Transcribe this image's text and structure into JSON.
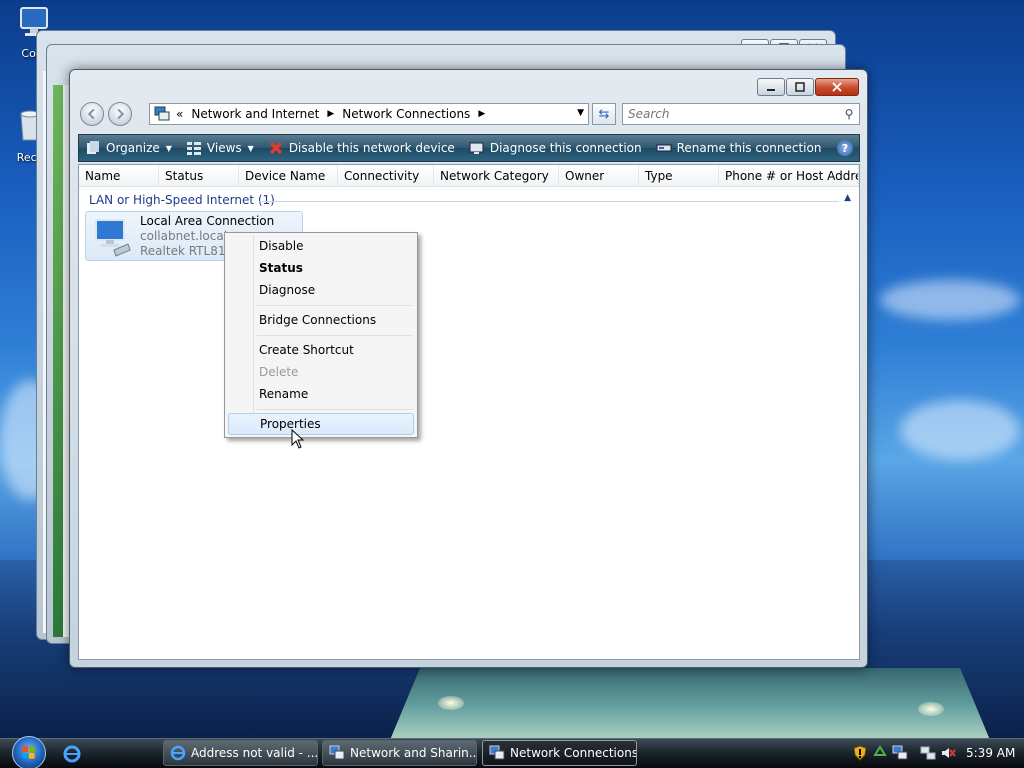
{
  "desktop": {
    "icons": [
      {
        "label": "Com"
      },
      {
        "label": "Recy"
      }
    ]
  },
  "window": {
    "address": {
      "crumbs": [
        "«",
        "Network and Internet",
        "Network Connections"
      ]
    },
    "search_placeholder": "Search",
    "toolbar": {
      "organize": "Organize",
      "views": "Views",
      "disable": "Disable this network device",
      "diagnose": "Diagnose this connection",
      "rename": "Rename this connection",
      "more": "»",
      "help": "?"
    },
    "columns": [
      "Name",
      "Status",
      "Device Name",
      "Connectivity",
      "Network Category",
      "Owner",
      "Type",
      "Phone # or Host Addre..."
    ],
    "group_label": "LAN or High-Speed Internet (1)",
    "item": {
      "name": "Local Area Connection",
      "network": "collabnet.local",
      "device": "Realtek RTL8139"
    }
  },
  "context_menu": {
    "items": [
      {
        "label": "Disable"
      },
      {
        "label": "Status"
      },
      {
        "label": "Diagnose"
      },
      {
        "label": "Bridge Connections"
      },
      {
        "label": "Create Shortcut"
      },
      {
        "label": "Delete"
      },
      {
        "label": "Rename"
      },
      {
        "label": "Properties"
      }
    ]
  },
  "taskbar": {
    "tasks": [
      {
        "label": "Address not valid - ..."
      },
      {
        "label": "Network and Sharin..."
      },
      {
        "label": "Network Connections"
      }
    ],
    "clock": "5:39 AM"
  },
  "colors": {
    "toolbar": "#2e5670",
    "menu_hover": "#d9e9fb",
    "group_text": "#1e3a8a"
  }
}
